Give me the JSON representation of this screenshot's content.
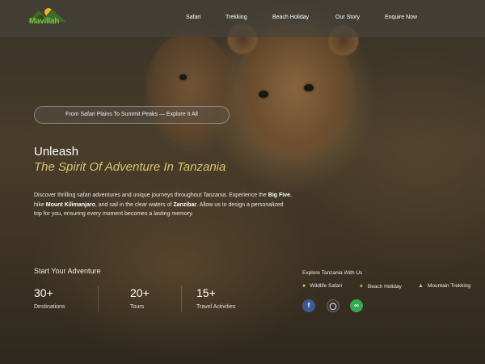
{
  "brand": {
    "logo_text": "Mavillah"
  },
  "nav": {
    "items": [
      "Safari",
      "Trekking",
      "Beach Holiday",
      "Our Story",
      "Enquire Now"
    ]
  },
  "hero": {
    "badge": "From Safari Plains To Summit Peaks — Explore It All",
    "title_line1": "Unleash",
    "title_line2": "The Spirit Of Adventure In Tanzania",
    "desc_part1": "Discover thrilling safari adventures and unique journeys throughout Tanzania. Experience the ",
    "desc_b1": "Big Five",
    "desc_part2": ", hike ",
    "desc_b2": "Mount Kilimanjaro",
    "desc_part3": ", and sail in the clear waters of ",
    "desc_b3": "Zanzibar",
    "desc_part4": ". Allow us to design a personalized trip for you, ensuring every moment becomes a lasting memory."
  },
  "stats": {
    "heading": "Start Your Adventure",
    "items": [
      {
        "value": "30+",
        "label": "Destinations"
      },
      {
        "value": "20+",
        "label": "Tours"
      },
      {
        "value": "15+",
        "label": "Travel Activities"
      }
    ]
  },
  "explore": {
    "title": "Explore Tanzania With Us",
    "tags": [
      {
        "icon": "pin-icon",
        "label": "Wildlife Safari"
      },
      {
        "icon": "palm-icon",
        "label": "Beach Holiday"
      },
      {
        "icon": "mountain-icon",
        "label": "Mountain Trekking"
      }
    ],
    "social": [
      {
        "icon": "facebook-icon",
        "color": "#3b5998"
      },
      {
        "icon": "instagram-icon",
        "color": "#3a3530"
      },
      {
        "icon": "tripadvisor-icon",
        "color": "#34a853"
      }
    ]
  },
  "colors": {
    "accent": "#d7c46a",
    "logo_green": "#7bbd3c",
    "nav_bg": "#46423a"
  }
}
